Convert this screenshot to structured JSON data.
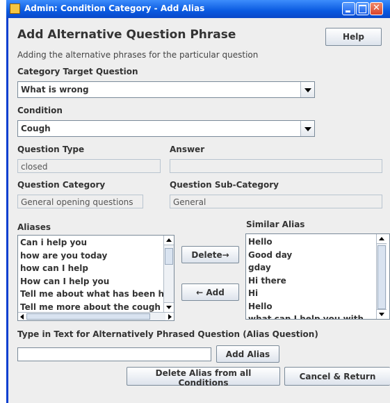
{
  "window": {
    "title": "Admin: Condition Category - Add Alias"
  },
  "header": {
    "heading": "Add Alternative Question Phrase",
    "help_label": "Help",
    "description": "Adding the alternative phrases for the particular question"
  },
  "target_question": {
    "label": "Category Target Question",
    "value": "What is wrong"
  },
  "condition": {
    "label": "Condition",
    "value": "Cough"
  },
  "question_type": {
    "label": "Question Type",
    "value": "closed"
  },
  "answer": {
    "label": "Answer",
    "value": ""
  },
  "question_category": {
    "label": "Question Category",
    "value": "General opening questions"
  },
  "question_subcategory": {
    "label": "Question Sub-Category",
    "value": "General"
  },
  "aliases": {
    "label": "Aliases",
    "items": [
      "Can i help you",
      "how are you today",
      "how can I help",
      "How can I help you",
      "Tell me about what has been happening",
      "Tell me more about the cough"
    ]
  },
  "similar_alias": {
    "label": "Similar Alias",
    "items": [
      "Hello",
      "Good day",
      "gday",
      "Hi there",
      "Hi",
      "Hello",
      "what can I help you with"
    ]
  },
  "actions": {
    "delete_label": "Delete→",
    "add_label": "← Add",
    "alias_text_label": "Type in Text for Alternatively Phrased Question (Alias Question)",
    "alias_input_value": "",
    "add_alias_label": "Add Alias",
    "delete_all_label": "Delete Alias from all Conditions",
    "cancel_label": "Cancel & Return"
  }
}
